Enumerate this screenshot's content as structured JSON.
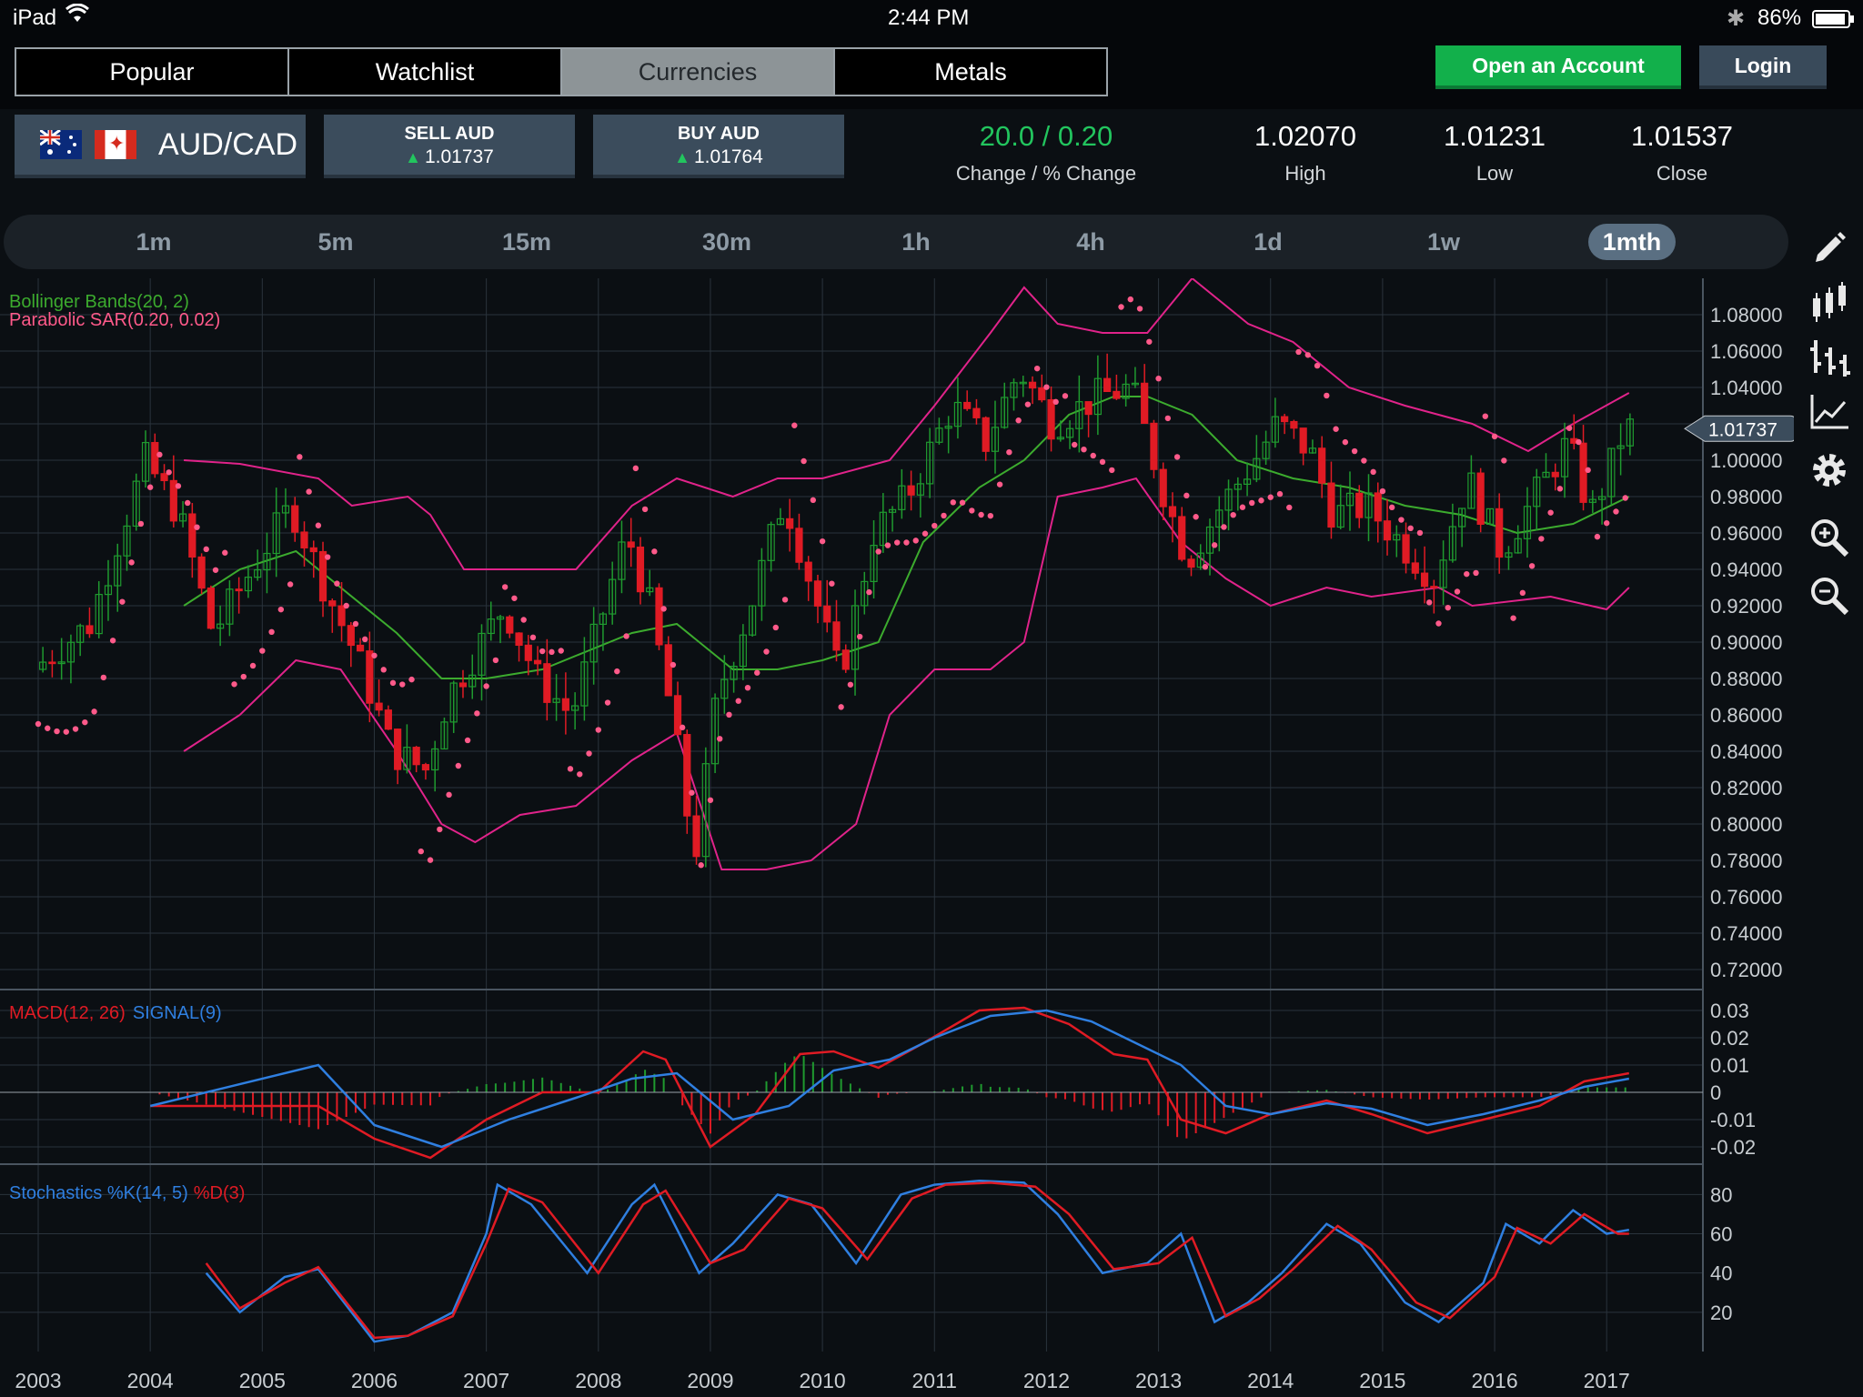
{
  "status": {
    "device": "iPad",
    "time": "2:44 PM",
    "battery": "86%"
  },
  "tabs": [
    {
      "label": "Popular",
      "active": false
    },
    {
      "label": "Watchlist",
      "active": false
    },
    {
      "label": "Currencies",
      "active": true
    },
    {
      "label": "Metals",
      "active": false
    }
  ],
  "header": {
    "open_account": "Open an Account",
    "login": "Login"
  },
  "quote": {
    "pair": "AUD/CAD",
    "sell_label": "SELL AUD",
    "sell_price": "1.01737",
    "buy_label": "BUY AUD",
    "buy_price": "1.01764",
    "change": "20.0 / 0.20",
    "change_label": "Change / % Change",
    "high": "1.02070",
    "high_label": "High",
    "low": "1.01231",
    "low_label": "Low",
    "close": "1.01537",
    "close_label": "Close"
  },
  "timeframes": [
    "1m",
    "5m",
    "15m",
    "30m",
    "1h",
    "4h",
    "1d",
    "1w",
    "1mth"
  ],
  "active_timeframe": "1mth",
  "tools": [
    "pencil-icon",
    "candlestick-icon",
    "bar-chart-icon",
    "line-chart-icon",
    "gear-icon",
    "zoom-in-icon",
    "zoom-out-icon"
  ],
  "colors": {
    "up": "#1f9a2f",
    "down": "#e01b24",
    "band": "#e0238a",
    "sar": "#ff5a8a",
    "mid": "#3cab2e",
    "macd": "#e01b24",
    "signal": "#2f7fe0",
    "green_btn": "#12b04b"
  },
  "chart_data": {
    "type": "candlestick",
    "indicators_label": [
      "Bollinger Bands(20, 2)",
      "Parabolic SAR(0.20, 0.02)"
    ],
    "price_ticks": [
      "1.08000",
      "1.06000",
      "1.04000",
      "1.02000",
      "1.00000",
      "0.98000",
      "0.96000",
      "0.94000",
      "0.92000",
      "0.90000",
      "0.88000",
      "0.86000",
      "0.84000",
      "0.82000",
      "0.80000",
      "0.78000",
      "0.76000",
      "0.74000",
      "0.72000"
    ],
    "ylim": [
      0.71,
      1.1
    ],
    "current_price": "1.01737",
    "x_ticks": [
      "2003",
      "2004",
      "2005",
      "2006",
      "2007",
      "2008",
      "2009",
      "2010",
      "2011",
      "2012",
      "2013",
      "2014",
      "2015",
      "2016",
      "2017"
    ],
    "x_range": [
      2003.0,
      2018.2
    ],
    "close_path": [
      [
        2003.0,
        0.885
      ],
      [
        2003.5,
        0.91
      ],
      [
        2004.0,
        1.0
      ],
      [
        2004.3,
        0.97
      ],
      [
        2004.6,
        0.905
      ],
      [
        2004.9,
        0.935
      ],
      [
        2005.3,
        0.975
      ],
      [
        2005.6,
        0.93
      ],
      [
        2005.9,
        0.89
      ],
      [
        2006.2,
        0.84
      ],
      [
        2006.5,
        0.83
      ],
      [
        2006.7,
        0.87
      ],
      [
        2007.0,
        0.9
      ],
      [
        2007.2,
        0.92
      ],
      [
        2007.5,
        0.88
      ],
      [
        2007.8,
        0.86
      ],
      [
        2008.0,
        0.9
      ],
      [
        2008.3,
        0.96
      ],
      [
        2008.5,
        0.92
      ],
      [
        2008.7,
        0.86
      ],
      [
        2008.9,
        0.78
      ],
      [
        2009.1,
        0.87
      ],
      [
        2009.4,
        0.92
      ],
      [
        2009.7,
        0.98
      ],
      [
        2009.9,
        0.94
      ],
      [
        2010.2,
        0.88
      ],
      [
        2010.5,
        0.96
      ],
      [
        2010.8,
        0.98
      ],
      [
        2011.2,
        1.03
      ],
      [
        2011.5,
        1.01
      ],
      [
        2011.8,
        1.05
      ],
      [
        2012.1,
        1.02
      ],
      [
        2012.5,
        1.035
      ],
      [
        2012.8,
        1.04
      ],
      [
        2013.1,
        0.98
      ],
      [
        2013.3,
        0.945
      ],
      [
        2013.6,
        0.975
      ],
      [
        2013.9,
        1.0
      ],
      [
        2014.1,
        1.02
      ],
      [
        2014.4,
        1.005
      ],
      [
        2014.6,
        0.97
      ],
      [
        2014.9,
        0.975
      ],
      [
        2015.2,
        0.955
      ],
      [
        2015.5,
        0.935
      ],
      [
        2015.8,
        0.99
      ],
      [
        2016.1,
        0.95
      ],
      [
        2016.4,
        0.98
      ],
      [
        2016.7,
        1.01
      ],
      [
        2016.9,
        0.97
      ],
      [
        2017.1,
        1.0
      ],
      [
        2017.2,
        1.0174
      ]
    ],
    "upper_band": [
      [
        2004.3,
        1.0
      ],
      [
        2004.8,
        0.998
      ],
      [
        2005.5,
        0.99
      ],
      [
        2005.8,
        0.975
      ],
      [
        2006.3,
        0.98
      ],
      [
        2006.5,
        0.97
      ],
      [
        2006.8,
        0.94
      ],
      [
        2007.2,
        0.94
      ],
      [
        2007.8,
        0.94
      ],
      [
        2008.3,
        0.975
      ],
      [
        2008.7,
        0.99
      ],
      [
        2009.2,
        0.98
      ],
      [
        2009.6,
        0.99
      ],
      [
        2010.0,
        0.99
      ],
      [
        2010.6,
        1.0
      ],
      [
        2011.0,
        1.03
      ],
      [
        2011.5,
        1.07
      ],
      [
        2011.8,
        1.095
      ],
      [
        2012.1,
        1.075
      ],
      [
        2012.5,
        1.07
      ],
      [
        2012.9,
        1.07
      ],
      [
        2013.3,
        1.1
      ],
      [
        2013.8,
        1.075
      ],
      [
        2014.2,
        1.065
      ],
      [
        2014.7,
        1.04
      ],
      [
        2015.2,
        1.03
      ],
      [
        2015.8,
        1.02
      ],
      [
        2016.3,
        1.005
      ],
      [
        2016.7,
        1.02
      ],
      [
        2017.2,
        1.037
      ]
    ],
    "lower_band": [
      [
        2004.3,
        0.84
      ],
      [
        2004.8,
        0.86
      ],
      [
        2005.3,
        0.89
      ],
      [
        2005.7,
        0.885
      ],
      [
        2006.2,
        0.84
      ],
      [
        2006.6,
        0.8
      ],
      [
        2006.9,
        0.79
      ],
      [
        2007.3,
        0.805
      ],
      [
        2007.8,
        0.81
      ],
      [
        2008.3,
        0.835
      ],
      [
        2008.7,
        0.85
      ],
      [
        2009.1,
        0.775
      ],
      [
        2009.5,
        0.775
      ],
      [
        2009.9,
        0.78
      ],
      [
        2010.3,
        0.8
      ],
      [
        2010.6,
        0.86
      ],
      [
        2011.0,
        0.885
      ],
      [
        2011.5,
        0.885
      ],
      [
        2011.8,
        0.9
      ],
      [
        2012.1,
        0.98
      ],
      [
        2012.5,
        0.985
      ],
      [
        2012.8,
        0.99
      ],
      [
        2013.2,
        0.955
      ],
      [
        2013.6,
        0.935
      ],
      [
        2014.0,
        0.92
      ],
      [
        2014.5,
        0.93
      ],
      [
        2014.9,
        0.925
      ],
      [
        2015.5,
        0.93
      ],
      [
        2015.8,
        0.92
      ],
      [
        2016.5,
        0.925
      ],
      [
        2017.0,
        0.918
      ],
      [
        2017.2,
        0.93
      ]
    ],
    "middle_band": [
      [
        2004.3,
        0.92
      ],
      [
        2004.8,
        0.94
      ],
      [
        2005.3,
        0.95
      ],
      [
        2005.7,
        0.93
      ],
      [
        2006.2,
        0.905
      ],
      [
        2006.6,
        0.88
      ],
      [
        2007.0,
        0.88
      ],
      [
        2007.5,
        0.885
      ],
      [
        2007.9,
        0.895
      ],
      [
        2008.3,
        0.905
      ],
      [
        2008.7,
        0.91
      ],
      [
        2009.2,
        0.885
      ],
      [
        2009.6,
        0.885
      ],
      [
        2010.0,
        0.89
      ],
      [
        2010.5,
        0.9
      ],
      [
        2010.9,
        0.955
      ],
      [
        2011.4,
        0.985
      ],
      [
        2011.8,
        1.0
      ],
      [
        2012.2,
        1.025
      ],
      [
        2012.6,
        1.035
      ],
      [
        2012.9,
        1.035
      ],
      [
        2013.3,
        1.025
      ],
      [
        2013.7,
        1.0
      ],
      [
        2014.2,
        0.99
      ],
      [
        2014.7,
        0.985
      ],
      [
        2015.2,
        0.975
      ],
      [
        2015.7,
        0.97
      ],
      [
        2016.2,
        0.96
      ],
      [
        2016.7,
        0.965
      ],
      [
        2017.2,
        0.98
      ]
    ],
    "macd_ticks": [
      "0.03",
      "0.02",
      "0.01",
      "0",
      "-0.01",
      "-0.02"
    ],
    "macd_ylim": [
      -0.025,
      0.035
    ],
    "macd_label": "MACD(12, 26)",
    "signal_label": "SIGNAL(9)",
    "macd": [
      [
        2004.0,
        -0.005
      ],
      [
        2005.5,
        -0.005
      ],
      [
        2006.0,
        -0.017
      ],
      [
        2006.5,
        -0.024
      ],
      [
        2007.0,
        -0.01
      ],
      [
        2007.5,
        0.0
      ],
      [
        2008.0,
        0.0
      ],
      [
        2008.4,
        0.015
      ],
      [
        2008.6,
        0.012
      ],
      [
        2009.0,
        -0.02
      ],
      [
        2009.4,
        -0.008
      ],
      [
        2009.8,
        0.014
      ],
      [
        2010.1,
        0.015
      ],
      [
        2010.5,
        0.009
      ],
      [
        2010.9,
        0.018
      ],
      [
        2011.4,
        0.03
      ],
      [
        2011.8,
        0.031
      ],
      [
        2012.2,
        0.025
      ],
      [
        2012.6,
        0.014
      ],
      [
        2012.9,
        0.012
      ],
      [
        2013.2,
        -0.01
      ],
      [
        2013.6,
        -0.015
      ],
      [
        2014.0,
        -0.008
      ],
      [
        2014.5,
        -0.003
      ],
      [
        2014.9,
        -0.008
      ],
      [
        2015.4,
        -0.015
      ],
      [
        2015.9,
        -0.01
      ],
      [
        2016.4,
        -0.005
      ],
      [
        2016.8,
        0.004
      ],
      [
        2017.2,
        0.007
      ]
    ],
    "signal": [
      [
        2004.0,
        -0.005
      ],
      [
        2005.5,
        0.01
      ],
      [
        2006.0,
        -0.012
      ],
      [
        2006.6,
        -0.02
      ],
      [
        2007.2,
        -0.01
      ],
      [
        2007.8,
        -0.002
      ],
      [
        2008.3,
        0.005
      ],
      [
        2008.7,
        0.007
      ],
      [
        2009.2,
        -0.01
      ],
      [
        2009.7,
        -0.005
      ],
      [
        2010.1,
        0.008
      ],
      [
        2010.6,
        0.012
      ],
      [
        2011.0,
        0.02
      ],
      [
        2011.5,
        0.028
      ],
      [
        2012.0,
        0.03
      ],
      [
        2012.4,
        0.026
      ],
      [
        2012.8,
        0.018
      ],
      [
        2013.2,
        0.01
      ],
      [
        2013.6,
        -0.005
      ],
      [
        2014.0,
        -0.008
      ],
      [
        2014.5,
        -0.004
      ],
      [
        2014.9,
        -0.006
      ],
      [
        2015.4,
        -0.012
      ],
      [
        2015.9,
        -0.008
      ],
      [
        2016.4,
        -0.003
      ],
      [
        2016.8,
        0.002
      ],
      [
        2017.2,
        0.005
      ]
    ],
    "stoch_ticks": [
      "80",
      "60",
      "40",
      "20"
    ],
    "stoch_ylim": [
      0,
      95
    ],
    "stoch_label": "Stochastics %K(14, 5)",
    "stoch_d_label": "%D(3)",
    "stoch_k": [
      [
        2004.5,
        40
      ],
      [
        2004.8,
        20
      ],
      [
        2005.2,
        38
      ],
      [
        2005.5,
        42
      ],
      [
        2006.0,
        5
      ],
      [
        2006.3,
        8
      ],
      [
        2006.7,
        20
      ],
      [
        2007.0,
        60
      ],
      [
        2007.1,
        85
      ],
      [
        2007.4,
        75
      ],
      [
        2007.9,
        40
      ],
      [
        2008.3,
        75
      ],
      [
        2008.5,
        85
      ],
      [
        2008.9,
        40
      ],
      [
        2009.2,
        55
      ],
      [
        2009.6,
        80
      ],
      [
        2009.9,
        75
      ],
      [
        2010.3,
        45
      ],
      [
        2010.7,
        80
      ],
      [
        2011.0,
        85
      ],
      [
        2011.4,
        87
      ],
      [
        2011.8,
        86
      ],
      [
        2012.1,
        70
      ],
      [
        2012.5,
        40
      ],
      [
        2012.9,
        45
      ],
      [
        2013.2,
        60
      ],
      [
        2013.5,
        15
      ],
      [
        2013.8,
        25
      ],
      [
        2014.1,
        40
      ],
      [
        2014.5,
        65
      ],
      [
        2014.8,
        55
      ],
      [
        2015.2,
        25
      ],
      [
        2015.5,
        15
      ],
      [
        2015.9,
        35
      ],
      [
        2016.1,
        65
      ],
      [
        2016.4,
        55
      ],
      [
        2016.7,
        72
      ],
      [
        2017.0,
        60
      ],
      [
        2017.2,
        62
      ]
    ],
    "stoch_d": [
      [
        2004.5,
        45
      ],
      [
        2004.8,
        22
      ],
      [
        2005.2,
        35
      ],
      [
        2005.5,
        43
      ],
      [
        2006.0,
        7
      ],
      [
        2006.3,
        8
      ],
      [
        2006.7,
        18
      ],
      [
        2007.0,
        55
      ],
      [
        2007.2,
        83
      ],
      [
        2007.5,
        76
      ],
      [
        2008.0,
        40
      ],
      [
        2008.4,
        75
      ],
      [
        2008.6,
        82
      ],
      [
        2009.0,
        45
      ],
      [
        2009.3,
        52
      ],
      [
        2009.7,
        78
      ],
      [
        2010.0,
        73
      ],
      [
        2010.4,
        47
      ],
      [
        2010.8,
        78
      ],
      [
        2011.1,
        85
      ],
      [
        2011.5,
        86
      ],
      [
        2011.9,
        84
      ],
      [
        2012.2,
        70
      ],
      [
        2012.6,
        42
      ],
      [
        2013.0,
        45
      ],
      [
        2013.3,
        58
      ],
      [
        2013.6,
        18
      ],
      [
        2013.9,
        27
      ],
      [
        2014.2,
        42
      ],
      [
        2014.6,
        64
      ],
      [
        2014.9,
        52
      ],
      [
        2015.3,
        25
      ],
      [
        2015.6,
        17
      ],
      [
        2016.0,
        38
      ],
      [
        2016.2,
        63
      ],
      [
        2016.5,
        55
      ],
      [
        2016.8,
        70
      ],
      [
        2017.1,
        60
      ],
      [
        2017.2,
        60
      ]
    ]
  }
}
